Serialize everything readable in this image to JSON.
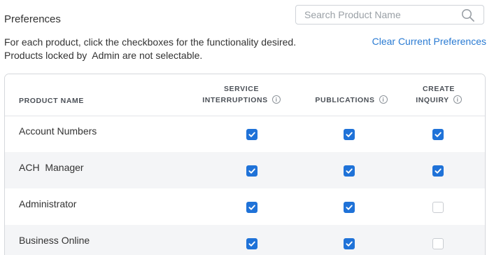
{
  "header": {
    "title": "Preferences",
    "search_placeholder": "Search Product Name"
  },
  "description": {
    "line1": "For each product, click the checkboxes for the functionality desired.",
    "line2": "Products locked by  Admin are not selectable."
  },
  "clear_link_label": "Clear Current Preferences",
  "table": {
    "columns": {
      "product_name": "PRODUCT NAME",
      "service_interruptions_1": "SERVICE",
      "service_interruptions_2": "INTERRUPTIONS",
      "publications": "PUBLICATIONS",
      "create_inquiry_1": "CREATE",
      "create_inquiry_2": "INQUIRY"
    },
    "rows": [
      {
        "name": "Account Numbers",
        "service_interruptions": true,
        "publications": true,
        "create_inquiry": true
      },
      {
        "name": "ACH  Manager",
        "service_interruptions": true,
        "publications": true,
        "create_inquiry": true
      },
      {
        "name": "Administrator",
        "service_interruptions": true,
        "publications": true,
        "create_inquiry": false
      },
      {
        "name": "Business Online",
        "service_interruptions": true,
        "publications": true,
        "create_inquiry": false
      }
    ]
  },
  "colors": {
    "accent": "#1f72d8",
    "link": "#2a7bd3",
    "row_alt": "#f4f5f7"
  },
  "icons": {
    "search": "search-icon",
    "info": "info-icon",
    "check": "checkmark-icon"
  }
}
